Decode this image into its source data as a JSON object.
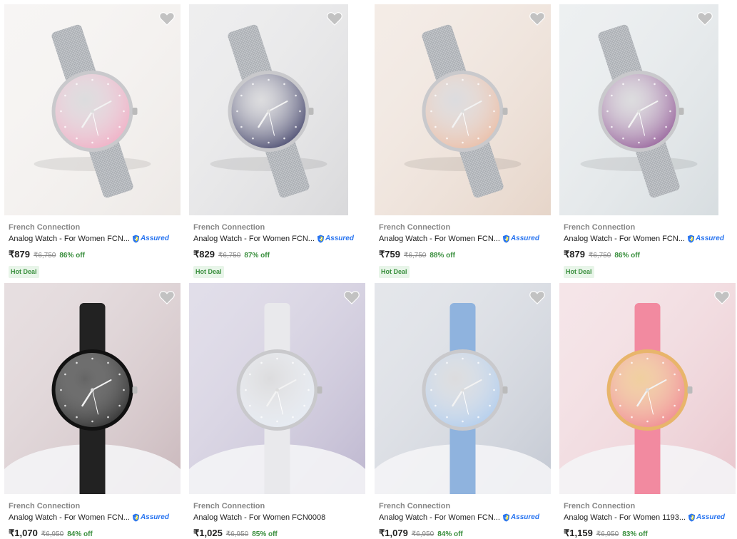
{
  "products": [
    {
      "brand": "French Connection",
      "title": "Analog Watch - For Women FCN...",
      "assured": true,
      "assured_label": "Assured",
      "price": "₹879",
      "mrp": "₹6,750",
      "discount": "86% off",
      "badge": "Hot Deal",
      "dial_color": "#f2a5bf",
      "strap": "mesh",
      "bg": "#ede9e6"
    },
    {
      "brand": "French Connection",
      "title": "Analog Watch - For Women FCN...",
      "assured": true,
      "assured_label": "Assured",
      "price": "₹829",
      "mrp": "₹6,750",
      "discount": "87% off",
      "badge": "Hot Deal",
      "dial_color": "#2e2f5a",
      "strap": "mesh",
      "bg": "#d9d9db"
    },
    {
      "brand": "French Connection",
      "title": "Analog Watch - For Women FCN...",
      "assured": true,
      "assured_label": "Assured",
      "price": "₹759",
      "mrp": "₹6,750",
      "discount": "88% off",
      "badge": "Hot Deal",
      "dial_color": "#ebb79c",
      "strap": "mesh",
      "bg": "#e6d5c9"
    },
    {
      "brand": "French Connection",
      "title": "Analog Watch - For Women FCN...",
      "assured": true,
      "assured_label": "Assured",
      "price": "₹879",
      "mrp": "₹6,750",
      "discount": "86% off",
      "badge": "Hot Deal",
      "dial_color": "#8a4d8f",
      "strap": "mesh",
      "bg": "#d7dde0"
    },
    {
      "brand": "French Connection",
      "title": "Analog Watch - For Women FCN...",
      "assured": true,
      "assured_label": "Assured",
      "price": "₹1,070",
      "mrp": "₹6,950",
      "discount": "84% off",
      "badge": "",
      "dial_color": "#1f1f1f",
      "strap": "black",
      "bg": "#c9b7bb"
    },
    {
      "brand": "French Connection",
      "title": "Analog Watch - For Women FCN0008",
      "assured": false,
      "assured_label": "",
      "price": "₹1,025",
      "mrp": "₹6,950",
      "discount": "85% off",
      "badge": "",
      "dial_color": "#e6ecf5",
      "strap": "white",
      "bg": "#bdb6cf"
    },
    {
      "brand": "French Connection",
      "title": "Analog Watch - For Women FCN...",
      "assured": true,
      "assured_label": "Assured",
      "price": "₹1,079",
      "mrp": "₹6,950",
      "discount": "84% off",
      "badge": "",
      "dial_color": "#a9c9ee",
      "strap": "blue",
      "bg": "#c3c8d2"
    },
    {
      "brand": "French Connection",
      "title": "Analog Watch - For Women 1193...",
      "assured": true,
      "assured_label": "Assured",
      "price": "₹1,159",
      "mrp": "₹6,950",
      "discount": "83% off",
      "badge": "",
      "dial_color": "#ef7d8b",
      "strap": "pink",
      "bg": "#e9c6cd"
    }
  ],
  "wishlist_icon": "heart-icon",
  "assured_icon": "shield-icon"
}
